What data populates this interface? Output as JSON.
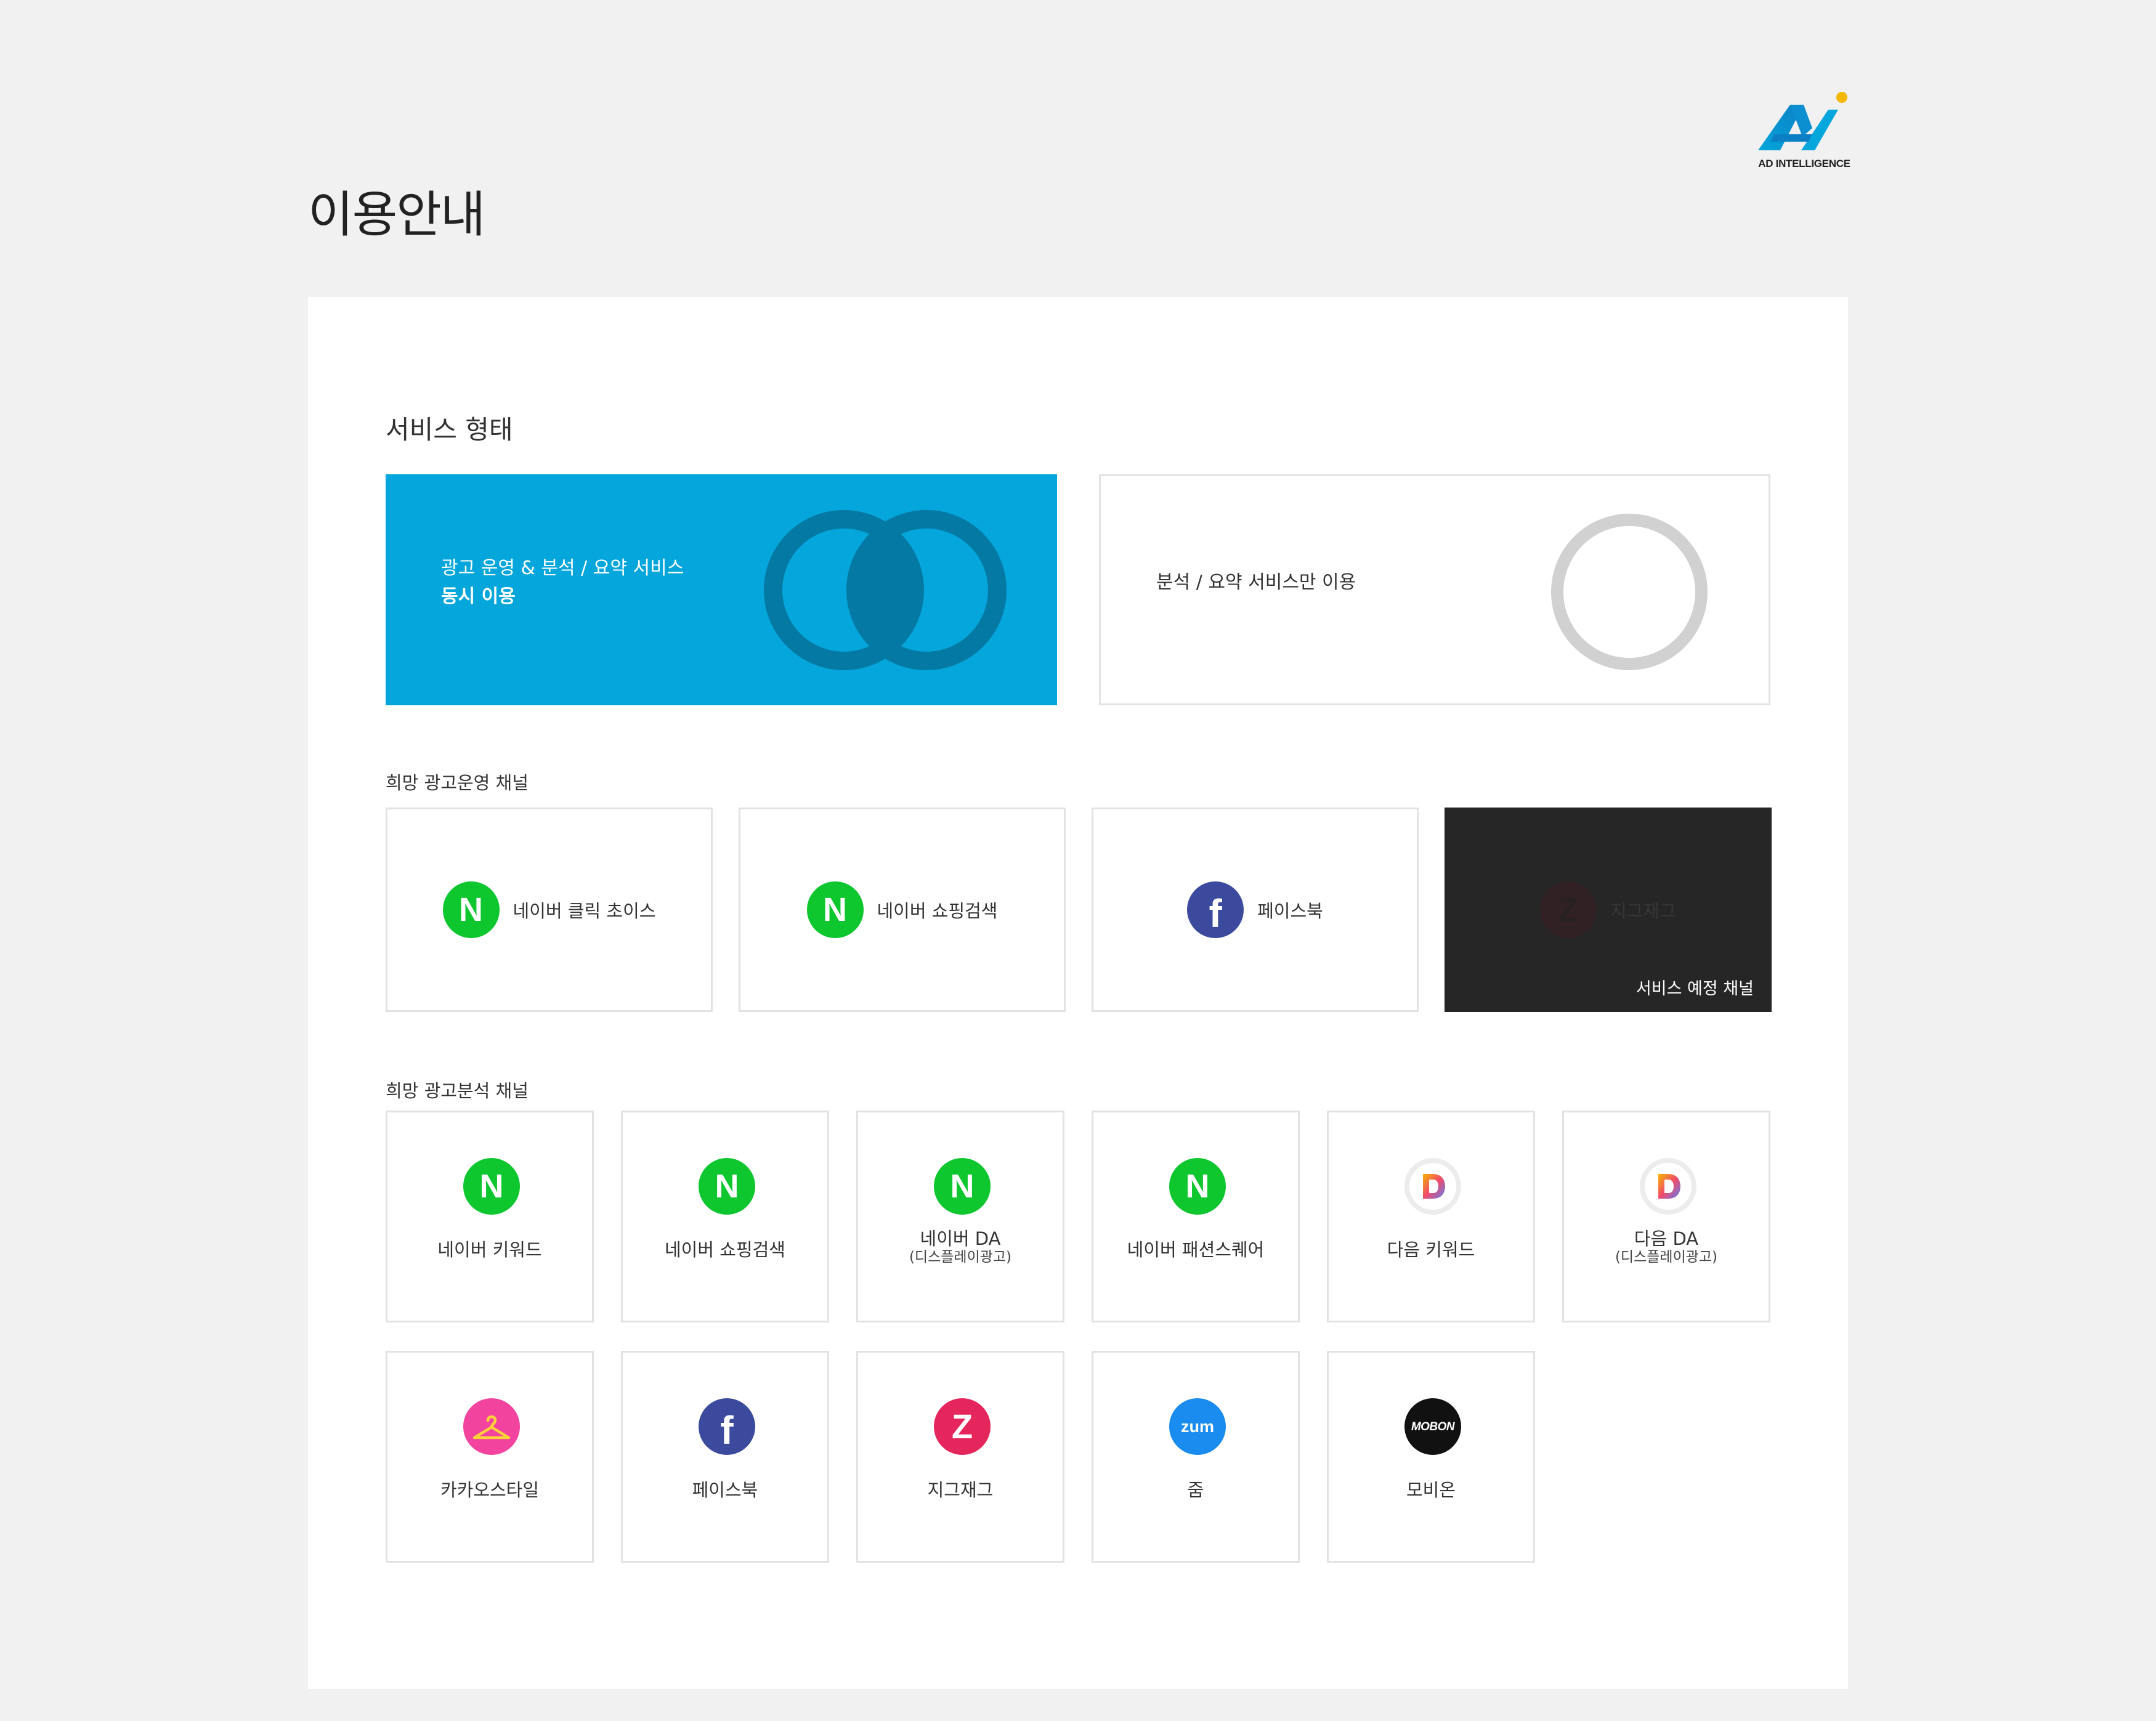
{
  "logo": {
    "text": "AD INTELLIGENCE"
  },
  "page": {
    "title": "이용안내"
  },
  "service_type": {
    "title": "서비스 형태",
    "options": [
      {
        "line1": "광고 운영 & 분석 / 요약 서비스",
        "line2": "동시 이용",
        "selected": true
      },
      {
        "line1": "분석 / 요약 서비스만 이용",
        "selected": false
      }
    ]
  },
  "ops_channels": {
    "title": "희망 광고운영 채널",
    "items": [
      {
        "label": "네이버 클릭 초이스",
        "icon": "naver-icon",
        "badge_text": "N"
      },
      {
        "label": "네이버 쇼핑검색",
        "icon": "naver-icon",
        "badge_text": "N"
      },
      {
        "label": "페이스북",
        "icon": "facebook-icon",
        "badge_text": "f"
      },
      {
        "label": "지그재그",
        "icon": "zigzag-icon",
        "badge_text": "Z",
        "badge": "서비스 예정 채널",
        "disabled": true
      }
    ]
  },
  "analysis_channels": {
    "title": "희망 광고분석 채널",
    "items": [
      {
        "label": "네이버 키워드",
        "icon": "naver-icon",
        "badge_text": "N"
      },
      {
        "label": "네이버 쇼핑검색",
        "icon": "naver-icon",
        "badge_text": "N"
      },
      {
        "label": "네이버 DA",
        "sub": "(디스플레이광고)",
        "icon": "naver-icon",
        "badge_text": "N"
      },
      {
        "label": "네이버 패션스퀘어",
        "icon": "naver-icon",
        "badge_text": "N"
      },
      {
        "label": "다음 키워드",
        "icon": "daum-icon"
      },
      {
        "label": "다음 DA",
        "sub": "(디스플레이광고)",
        "icon": "daum-icon"
      },
      {
        "label": "카카오스타일",
        "icon": "kakaostyle-icon"
      },
      {
        "label": "페이스북",
        "icon": "facebook-icon",
        "badge_text": "f"
      },
      {
        "label": "지그재그",
        "icon": "zigzag-icon",
        "badge_text": "Z"
      },
      {
        "label": "줌",
        "icon": "zum-icon",
        "badge_text": "zum"
      },
      {
        "label": "모비온",
        "icon": "mobon-icon",
        "badge_text": "MOBON"
      }
    ]
  },
  "colors": {
    "accent_blue": "#05a6db",
    "overlap_blue": "#0479a3",
    "naver_green": "#0ec62e",
    "facebook_blue": "#3c4a9e",
    "zigzag_pink": "#e5265c",
    "zum_blue": "#1a8cf0",
    "disabled_bg": "#262626",
    "border": "#e2e2e2"
  }
}
